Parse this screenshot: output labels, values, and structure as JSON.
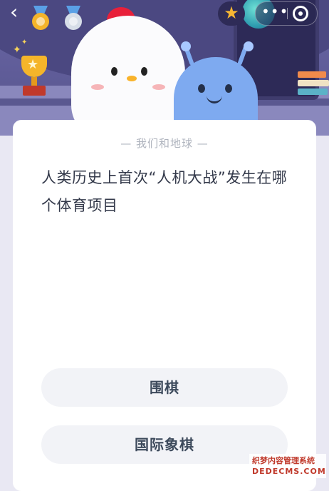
{
  "header": {
    "back_label": "‹",
    "medals": [
      {
        "name": "gold-medal",
        "color": "#f4b42a"
      },
      {
        "name": "silver-medal",
        "color": "#d7dee8"
      }
    ],
    "star_icon": "★",
    "more_label": "•••"
  },
  "card": {
    "subject": "— 我们和地球 —",
    "question": "人类历史上首次“人机大战”发生在哪个体育项目",
    "options": [
      {
        "label": "围棋"
      },
      {
        "label": "国际象棋"
      }
    ]
  },
  "watermark": {
    "line1": "织梦内容管理系统",
    "line2": "DEDECMS.COM"
  },
  "colors": {
    "scene_bg": "#5f5c98",
    "card_bg": "#ffffff",
    "option_bg": "#f2f3f7",
    "question_text": "#33394a",
    "accent_star": "#f7b733"
  }
}
